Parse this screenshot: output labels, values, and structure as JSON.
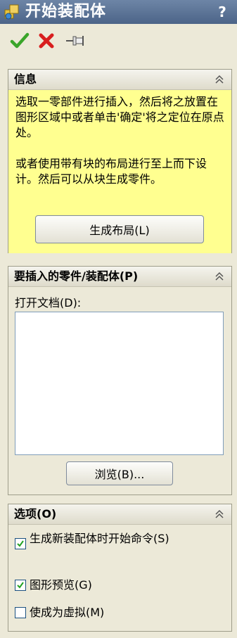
{
  "title": "开始装配体",
  "help": "?",
  "toolbar": {
    "ok_icon": "checkmark-icon",
    "cancel_icon": "x-icon",
    "pin_icon": "pushpin-icon"
  },
  "info_panel": {
    "header": "信息",
    "text1": "选取一零部件进行插入，然后将之放置在图形区域中或者单击'确定'将之定位在原点处。",
    "text2": "或者使用带有块的布局进行至上而下设计。然后可以从块生成零件。",
    "button_label": "生成布局(L)"
  },
  "insert_panel": {
    "header": "要插入的零件/装配体(P)",
    "open_docs_label": "打开文档(D):",
    "browse_label": "浏览(B)..."
  },
  "options_panel": {
    "header": "选项(O)",
    "options": [
      {
        "label": "生成新装配体时开始命令(S)",
        "checked": true
      },
      {
        "label": "图形预览(G)",
        "checked": true
      },
      {
        "label": "使成为虚拟(M)",
        "checked": false
      }
    ]
  },
  "colors": {
    "titlebar": "#4c6488",
    "info_bg": "#ffff90",
    "panel_bg": "#ece9d8",
    "ok_green": "#3aa52a",
    "cancel_red": "#d81e1e"
  }
}
